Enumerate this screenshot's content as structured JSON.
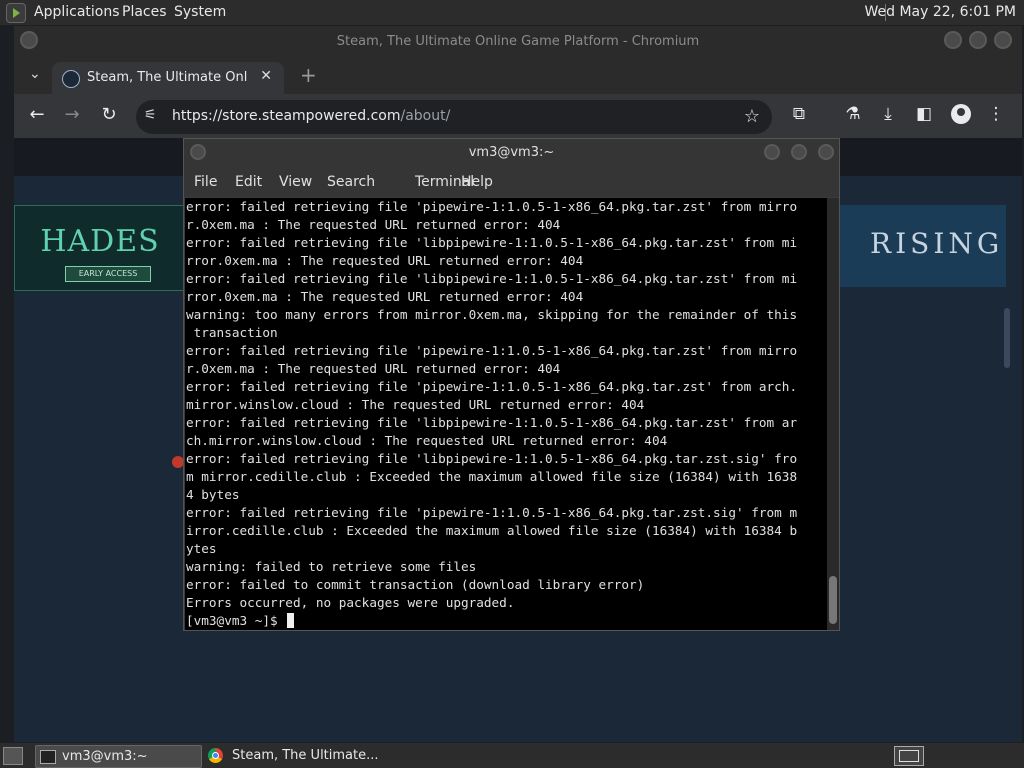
{
  "top_panel": {
    "menu": [
      "Applications",
      "Places",
      "System"
    ],
    "clock": "Wed May 22,  6:01 PM"
  },
  "browser": {
    "window_title": "Steam, The Ultimate Online Game Platform - Chromium",
    "tab": {
      "title": "Steam, The Ultimate Online",
      "close": "✕"
    },
    "new_tab": "+",
    "url": {
      "host": "https://store.steampowered.com",
      "path": "/about/"
    },
    "page": {
      "hades_title": "HADES",
      "hades_badge": "EARLY ACCESS",
      "rising_text": "RISING"
    }
  },
  "terminal": {
    "title": "vm3@vm3:~",
    "menu": [
      "File",
      "Edit",
      "View",
      "Search",
      "Terminal",
      "Help"
    ],
    "lines": [
      "error: failed retrieving file 'pipewire-1:1.0.5-1-x86_64.pkg.tar.zst' from mirro",
      "r.0xem.ma : The requested URL returned error: 404",
      "error: failed retrieving file 'libpipewire-1:1.0.5-1-x86_64.pkg.tar.zst' from mi",
      "rror.0xem.ma : The requested URL returned error: 404",
      "error: failed retrieving file 'libpipewire-1:1.0.5-1-x86_64.pkg.tar.zst' from mi",
      "rror.0xem.ma : The requested URL returned error: 404",
      "warning: too many errors from mirror.0xem.ma, skipping for the remainder of this",
      " transaction",
      "error: failed retrieving file 'pipewire-1:1.0.5-1-x86_64.pkg.tar.zst' from mirro",
      "r.0xem.ma : The requested URL returned error: 404",
      "error: failed retrieving file 'pipewire-1:1.0.5-1-x86_64.pkg.tar.zst' from arch.",
      "mirror.winslow.cloud : The requested URL returned error: 404",
      "error: failed retrieving file 'libpipewire-1:1.0.5-1-x86_64.pkg.tar.zst' from ar",
      "ch.mirror.winslow.cloud : The requested URL returned error: 404",
      "error: failed retrieving file 'libpipewire-1:1.0.5-1-x86_64.pkg.tar.zst.sig' fro",
      "m mirror.cedille.club : Exceeded the maximum allowed file size (16384) with 1638",
      "4 bytes",
      "error: failed retrieving file 'pipewire-1:1.0.5-1-x86_64.pkg.tar.zst.sig' from m",
      "irror.cedille.club : Exceeded the maximum allowed file size (16384) with 16384 b",
      "ytes",
      "warning: failed to retrieve some files",
      "error: failed to commit transaction (download library error)",
      "Errors occurred, no packages were upgraded."
    ],
    "prompt": "[vm3@vm3 ~]$ "
  },
  "taskbar": {
    "items": [
      {
        "label": "vm3@vm3:~",
        "icon": "terminal-icon"
      },
      {
        "label": "Steam, The Ultimate...",
        "icon": "chromium-icon"
      }
    ]
  }
}
